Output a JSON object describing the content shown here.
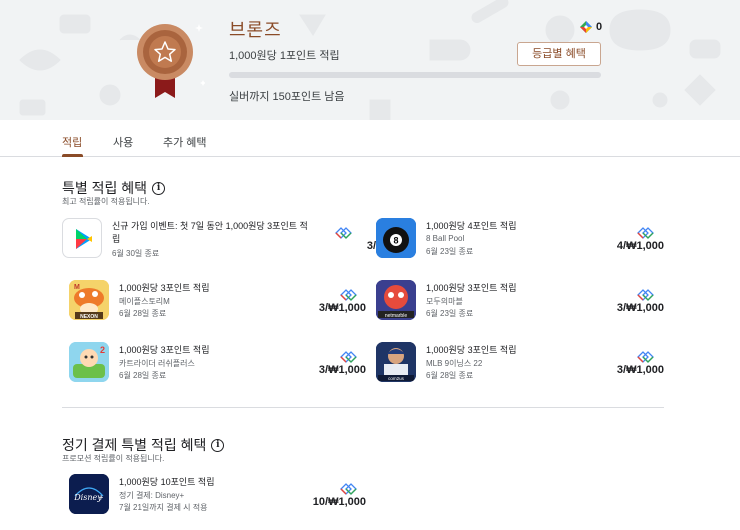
{
  "header": {
    "tier_name": "브론즈",
    "tier_desc": "1,000원당 1포인트 적립",
    "progress_fraction": 0.0,
    "tier_remaining": "실버까지 150포인트 남음",
    "points_balance": "0",
    "benefits_button": "등급별 혜택",
    "medal_icon": "bronze-medal-icon",
    "accent_color": "#8a4b27"
  },
  "tabs": [
    {
      "label": "적립",
      "active": true
    },
    {
      "label": "사용",
      "active": false
    },
    {
      "label": "추가 혜택",
      "active": false
    }
  ],
  "special": {
    "title": "특별 적립 혜택",
    "subtitle": "최고 적립률이 적용됩니다.",
    "offers": [
      {
        "icon": "google-play-icon",
        "title": "신규 가입 이벤트: 첫 7일 동안 1,000원당 3포인트 적립",
        "sub1": "",
        "sub2": "6월 30일 종료",
        "rate": "3/₩1,000"
      },
      {
        "icon": "8-ball-pool-icon",
        "title": "1,000원당 4포인트 적립",
        "sub1": "8 Ball Pool",
        "sub2": "6월 23일 종료",
        "rate": "4/₩1,000"
      },
      {
        "icon": "maplestory-m-icon",
        "title": "1,000원당 3포인트 적립",
        "sub1": "메이플스토리M",
        "sub2": "6월 28일 종료",
        "rate": "3/₩1,000"
      },
      {
        "icon": "modoo-marble-icon",
        "title": "1,000원당 3포인트 적립",
        "sub1": "모두의마블",
        "sub2": "6월 23일 종료",
        "rate": "3/₩1,000"
      },
      {
        "icon": "kartrider-rush-plus-icon",
        "title": "1,000원당 3포인트 적립",
        "sub1": "카트라이더 러쉬플러스",
        "sub2": "6월 28일 종료",
        "rate": "3/₩1,000"
      },
      {
        "icon": "mlb-9innings-22-icon",
        "title": "1,000원당 3포인트 적립",
        "sub1": "MLB 9이닝스 22",
        "sub2": "6월 28일 종료",
        "rate": "3/₩1,000"
      }
    ]
  },
  "subscription": {
    "title": "정기 결제 특별 적립 혜택",
    "subtitle": "프로모션 적립률이 적용됩니다.",
    "offers": [
      {
        "icon": "disney-plus-icon",
        "title": "1,000원당 10포인트 적립",
        "sub1": "정기 결제: Disney+",
        "sub2": "7월 21일까지 결제 시 적용",
        "rate": "10/₩1,000"
      }
    ]
  }
}
